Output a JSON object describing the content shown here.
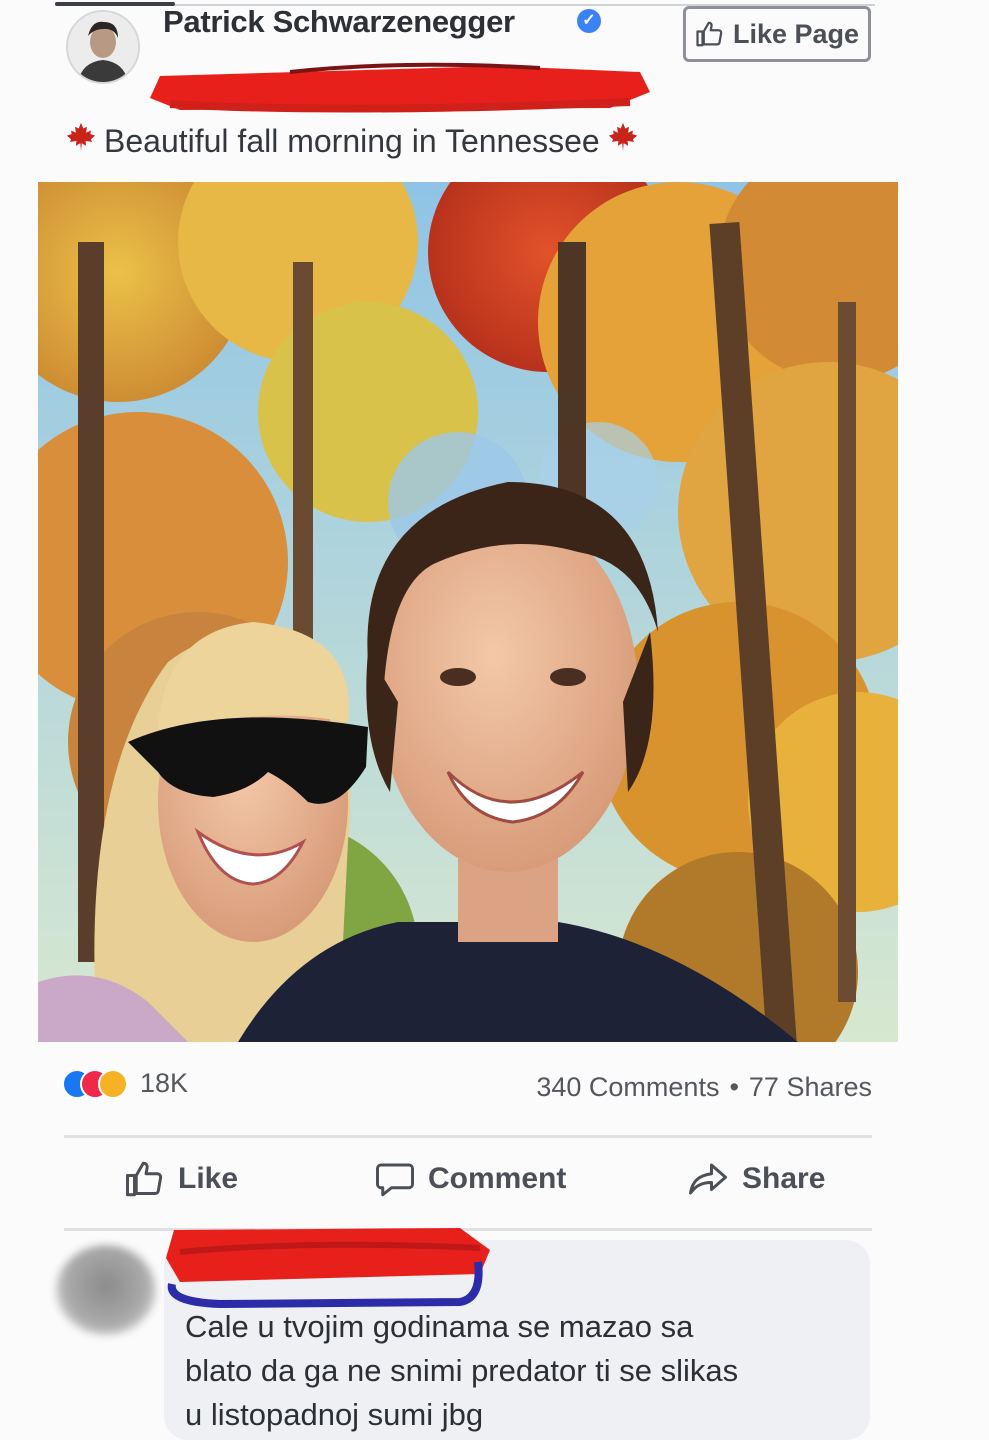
{
  "post": {
    "author": "Patrick Schwarzenegger",
    "like_page_label": "Like Page",
    "caption": "Beautiful fall morning in Tennessee",
    "leaf_icon": "maple-leaf-icon"
  },
  "stats": {
    "reactions_count": "18K",
    "comments": "340 Comments",
    "separator": "•",
    "shares": "77 Shares"
  },
  "actions": {
    "like": "Like",
    "comment": "Comment",
    "share": "Share"
  },
  "comment": {
    "text": "Cale u tvojim godinama se mazao sa\nblato da ga ne snimi predator ti se slikas\nu listopadnoj sumi jbg"
  },
  "colors": {
    "redaction_red": "#e8201c",
    "redaction_blue": "#2c2ca8",
    "verified_blue": "#3b82f6",
    "leaf_red": "#c8241c"
  }
}
